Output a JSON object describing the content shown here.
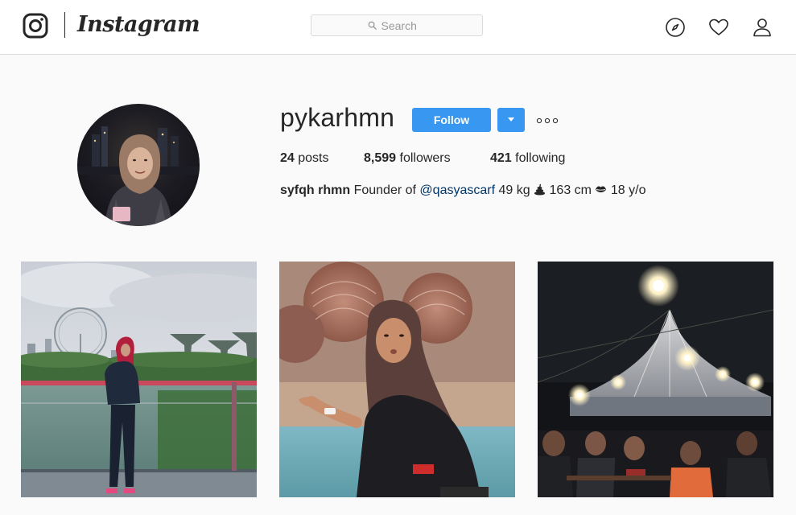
{
  "nav": {
    "brand": "Instagram",
    "search_placeholder": "Search",
    "icons": [
      "instagram-camera-icon",
      "search-icon",
      "explore-compass-icon",
      "activity-heart-icon",
      "profile-person-icon"
    ]
  },
  "profile": {
    "username": "pykarhmn",
    "follow_label": "Follow",
    "stats": {
      "posts_count": "24",
      "posts_label": "posts",
      "followers_count": "8,599",
      "followers_label": "followers",
      "following_count": "421",
      "following_label": "following"
    },
    "bio": {
      "full_name": "syfqh rhmn",
      "text_1": "Founder of",
      "mention": "@qasyascarf",
      "text_2": "49 kg",
      "text_3": "163 cm",
      "text_4": "18 y/o"
    }
  },
  "posts": [
    {
      "id": "post-1",
      "scene": "girl on bridge with Singapore Flyer and Supertrees"
    },
    {
      "id": "post-2",
      "scene": "girl in hijab at pool with sea urchin rocks"
    },
    {
      "id": "post-3",
      "scene": "night tent with string lights and people at tables"
    }
  ],
  "colors": {
    "accent": "#3897f0",
    "background": "#fafafa",
    "text": "#262626",
    "border": "#dbdbdb",
    "link": "#003569"
  }
}
